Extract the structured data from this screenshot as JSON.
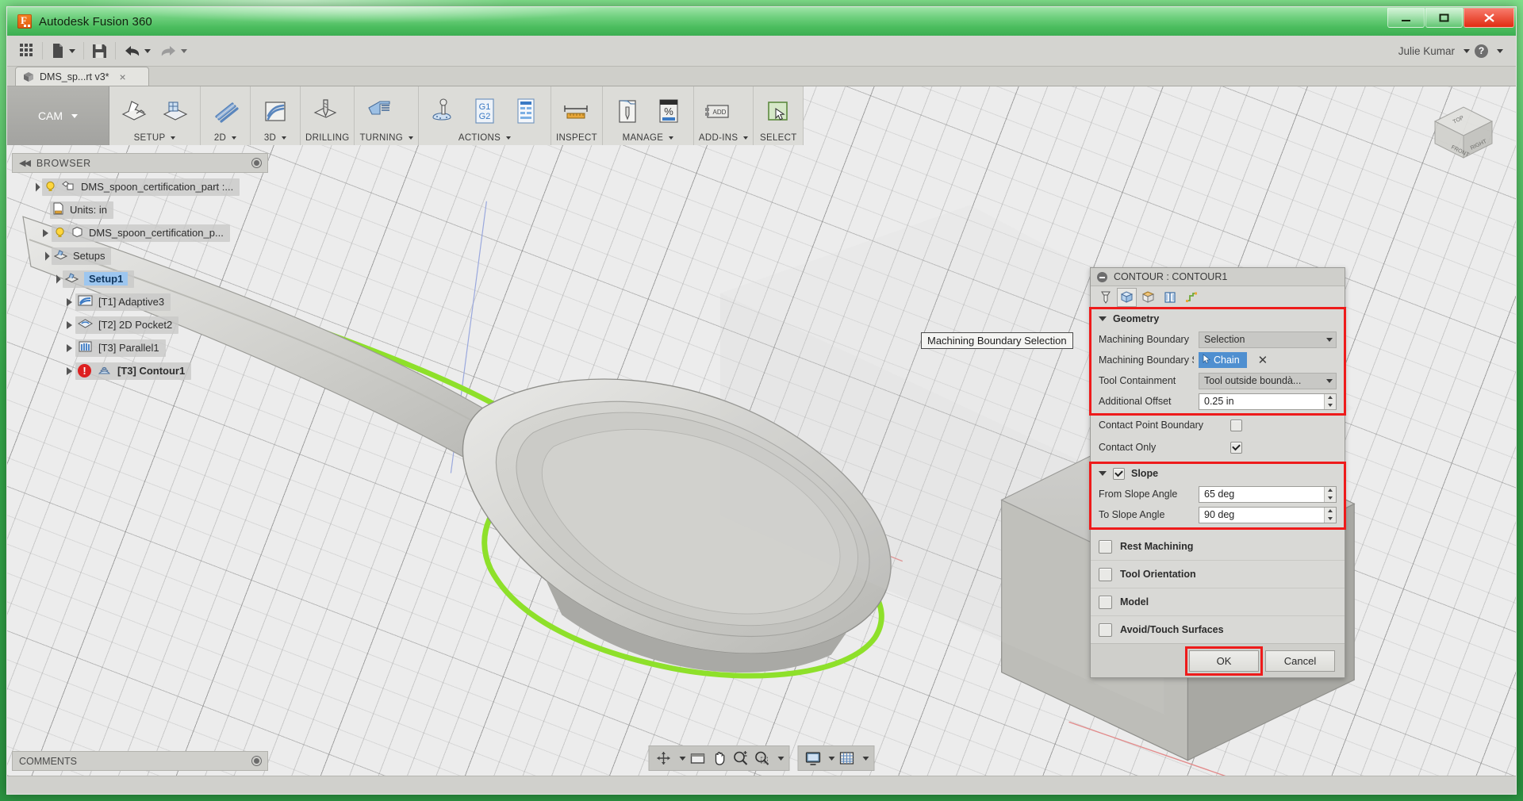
{
  "window": {
    "title": "Autodesk Fusion 360",
    "app_icon": "fusion-logo-icon",
    "buttons": {
      "minimize": "minimize-icon",
      "maximize": "maximize-icon",
      "close": "close-icon"
    }
  },
  "apptoolbar": {
    "show_grid": "app-grid-icon",
    "new": "new-document-icon",
    "save": "save-icon",
    "undo": "undo-icon",
    "redo": "redo-icon",
    "user": "Julie Kumar",
    "help": "?"
  },
  "doctab": {
    "label": "DMS_sp...rt v3*",
    "close": "×",
    "icon": "cube-icon"
  },
  "ribbon": {
    "workspace": "CAM",
    "groups": [
      {
        "label": "SETUP",
        "has_caret": true,
        "icons": [
          "setup-icon",
          "setup-folder-icon"
        ]
      },
      {
        "label": "2D",
        "has_caret": true,
        "icons": [
          "2d-toolpath-icon"
        ]
      },
      {
        "label": "3D",
        "has_caret": true,
        "icons": [
          "3d-toolpath-icon"
        ]
      },
      {
        "label": "DRILLING",
        "has_caret": false,
        "icons": [
          "drilling-icon"
        ]
      },
      {
        "label": "TURNING",
        "has_caret": true,
        "icons": [
          "turning-icon"
        ]
      },
      {
        "label": "ACTIONS",
        "has_caret": true,
        "icons": [
          "simulate-icon",
          "post-process-g1g2-icon",
          "setup-sheet-icon"
        ]
      },
      {
        "label": "INSPECT",
        "has_caret": false,
        "icons": [
          "measure-ruler-icon"
        ]
      },
      {
        "label": "MANAGE",
        "has_caret": true,
        "icons": [
          "tool-library-icon",
          "machining-time-percent-icon"
        ]
      },
      {
        "label": "ADD-INS",
        "has_caret": true,
        "icons": [
          "add-ins-icon"
        ]
      },
      {
        "label": "SELECT",
        "has_caret": false,
        "icons": [
          "select-icon"
        ]
      }
    ]
  },
  "browser": {
    "title": "BROWSER",
    "collapse_icon": "collapse-arrows-icon",
    "tree": [
      {
        "label": "DMS_spoon_certification_part :...",
        "indent": 0,
        "arrow": "open",
        "bulb": true,
        "icon": "assembly-icon",
        "selected": false,
        "bold": false,
        "error": false
      },
      {
        "label": "Units: in",
        "indent": 1,
        "arrow": "none",
        "bulb": false,
        "icon": "document-units-icon",
        "selected": false,
        "bold": false,
        "error": false
      },
      {
        "label": "DMS_spoon_certification_p...",
        "indent": 1,
        "arrow": "closed",
        "bulb": true,
        "icon": "body-icon",
        "selected": false,
        "bold": false,
        "error": false
      },
      {
        "label": "Setups",
        "indent": 1,
        "arrow": "open",
        "bulb": false,
        "icon": "setup-icon",
        "selected": false,
        "bold": false,
        "error": false
      },
      {
        "label": "Setup1",
        "indent": 2,
        "arrow": "open",
        "bulb": false,
        "icon": "setup-icon",
        "selected": true,
        "bold": true,
        "error": false
      },
      {
        "label": "[T1] Adaptive3",
        "indent": 3,
        "arrow": "closed",
        "bulb": false,
        "icon": "adaptive-icon",
        "selected": false,
        "bold": false,
        "error": false
      },
      {
        "label": "[T2] 2D Pocket2",
        "indent": 3,
        "arrow": "closed",
        "bulb": false,
        "icon": "pocket-icon",
        "selected": false,
        "bold": false,
        "error": false
      },
      {
        "label": "[T3] Parallel1",
        "indent": 3,
        "arrow": "closed",
        "bulb": false,
        "icon": "parallel-icon",
        "selected": false,
        "bold": false,
        "error": false
      },
      {
        "label": "[T3] Contour1",
        "indent": 3,
        "arrow": "closed",
        "bulb": false,
        "icon": "contour-icon",
        "selected": false,
        "bold": true,
        "error": true
      }
    ]
  },
  "tooltip": {
    "text": "Machining Boundary Selection"
  },
  "dialog": {
    "title": "CONTOUR : CONTOUR1",
    "collapse_icon": "minus-circle-icon",
    "tabs": [
      {
        "name": "tool-tab",
        "icon": "end-mill-icon",
        "active": false
      },
      {
        "name": "geometry-tab",
        "icon": "geometry-cube-icon",
        "active": true
      },
      {
        "name": "heights-tab",
        "icon": "heights-cube-icon",
        "active": false
      },
      {
        "name": "passes-tab",
        "icon": "passes-icon",
        "active": false
      },
      {
        "name": "linking-tab",
        "icon": "linking-icon",
        "active": false
      }
    ],
    "geometry": {
      "title": "Geometry",
      "expanded": true,
      "highlighted": true,
      "machining_boundary": {
        "label": "Machining Boundary",
        "value": "Selection"
      },
      "machining_boundary_selection": {
        "label": "Machining Boundary S...",
        "button": "Chain",
        "clear": "✕"
      },
      "tool_containment": {
        "label": "Tool Containment",
        "value": "Tool outside boundà..."
      },
      "additional_offset": {
        "label": "Additional Offset",
        "value": "0.25 in"
      }
    },
    "contact_point_boundary": {
      "label": "Contact Point Boundary",
      "checked": false
    },
    "contact_only": {
      "label": "Contact Only",
      "checked": true
    },
    "slope": {
      "title": "Slope",
      "checked": true,
      "expanded": true,
      "highlighted": true,
      "from_slope_angle": {
        "label": "From Slope Angle",
        "value": "65 deg"
      },
      "to_slope_angle": {
        "label": "To Slope Angle",
        "value": "90 deg"
      }
    },
    "sections": [
      {
        "label": "Rest Machining",
        "checked": false
      },
      {
        "label": "Tool Orientation",
        "checked": false
      },
      {
        "label": "Model",
        "checked": false
      },
      {
        "label": "Avoid/Touch Surfaces",
        "checked": false
      }
    ],
    "footer": {
      "ok": "OK",
      "cancel": "Cancel",
      "ok_highlighted": true
    }
  },
  "navbar": {
    "group1": [
      {
        "name": "orbit-icon",
        "caret": true
      },
      {
        "name": "viewports-icon",
        "caret": false
      },
      {
        "name": "pan-hand-icon",
        "caret": false
      },
      {
        "name": "zoom-icon",
        "caret": false
      },
      {
        "name": "zoom-window-icon",
        "caret": true
      }
    ],
    "group2": [
      {
        "name": "display-settings-icon",
        "caret": true
      },
      {
        "name": "grid-snaps-icon",
        "caret": true
      }
    ]
  },
  "comments": {
    "label": "COMMENTS"
  },
  "viewcube": {
    "faces": [
      "FRONT",
      "RIGHT",
      "TOP"
    ]
  },
  "colors": {
    "accent_blue": "#4f8fd0",
    "highlight_red": "#ee1b1b",
    "selection_green": "#8ee02a",
    "error_red": "#dd1f1f",
    "frame_green": "#35a84a"
  }
}
